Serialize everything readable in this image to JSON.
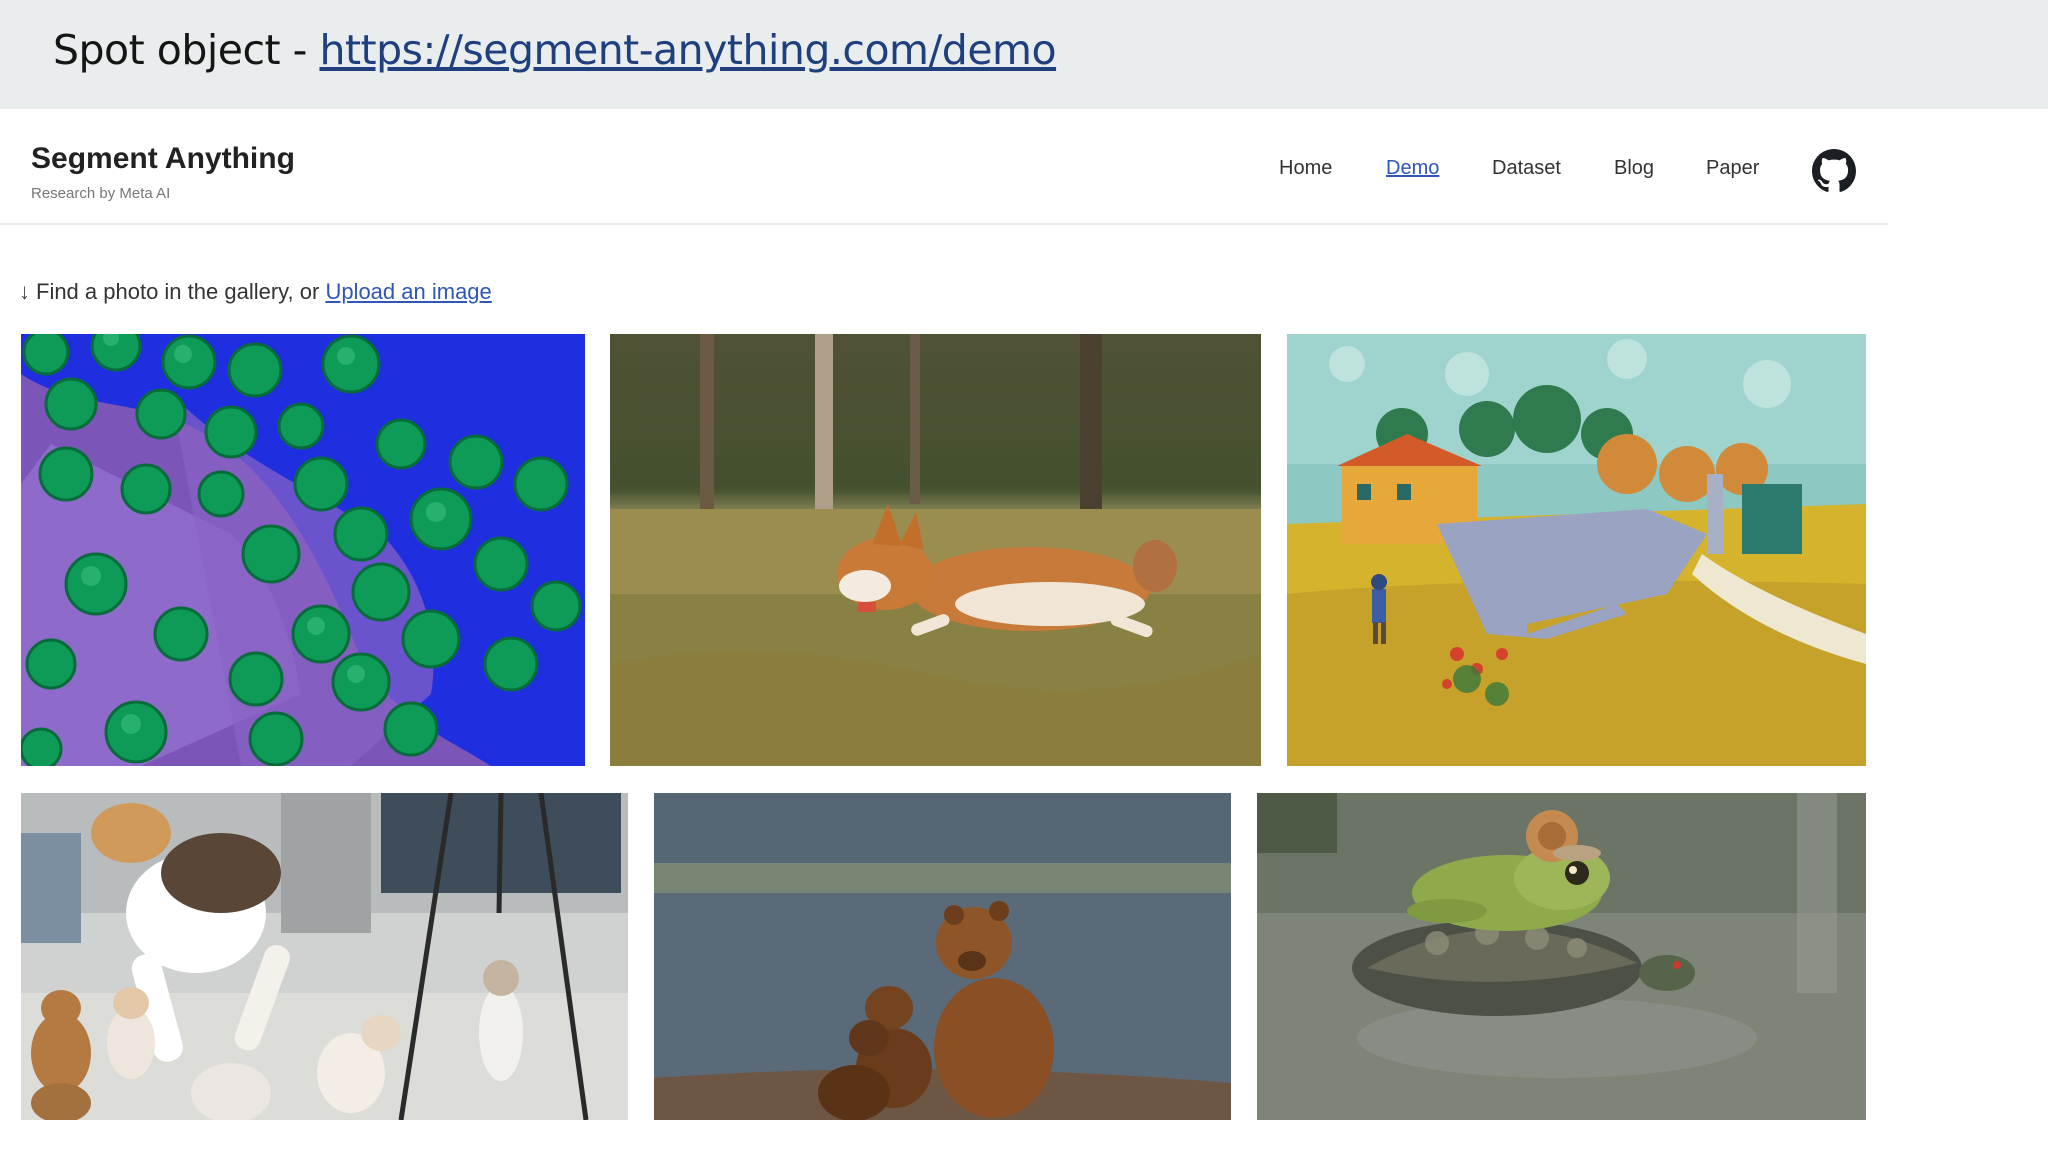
{
  "slide": {
    "caption_prefix": "Spot object - ",
    "caption_link": "https://segment-anything.com/demo"
  },
  "site": {
    "title": "Segment Anything",
    "subtitle": "Research by Meta AI",
    "nav": [
      {
        "label": "Home"
      },
      {
        "label": "Demo",
        "active": true
      },
      {
        "label": "Dataset"
      },
      {
        "label": "Blog"
      },
      {
        "label": "Paper"
      }
    ],
    "github_icon": "github-icon"
  },
  "gallery": {
    "prompt_arrow": "↓",
    "prompt_text": "Find a photo in the gallery, or ",
    "upload_link": "Upload an image",
    "photos": [
      {
        "name": "cells"
      },
      {
        "name": "corgi"
      },
      {
        "name": "painting"
      },
      {
        "name": "cats"
      },
      {
        "name": "bears"
      },
      {
        "name": "frog-turtle"
      }
    ]
  },
  "colors": {
    "link": "#2f56b8",
    "caption_bar": "#e9eded"
  }
}
